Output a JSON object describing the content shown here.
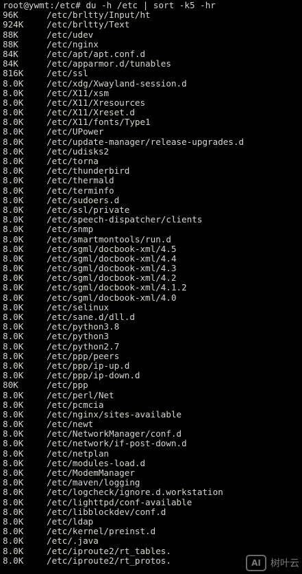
{
  "terminal": {
    "prompt": "root@ywmt:/etc# du -h /etc | sort -k5 -hr",
    "rows": [
      {
        "size": "96K",
        "path": "/etc/brltty/Input/ht"
      },
      {
        "size": "924K",
        "path": "/etc/brltty/Text"
      },
      {
        "size": "88K",
        "path": "/etc/udev"
      },
      {
        "size": "88K",
        "path": "/etc/nginx"
      },
      {
        "size": "84K",
        "path": "/etc/apt/apt.conf.d"
      },
      {
        "size": "84K",
        "path": "/etc/apparmor.d/tunables"
      },
      {
        "size": "816K",
        "path": "/etc/ssl"
      },
      {
        "size": "8.0K",
        "path": "/etc/xdg/Xwayland-session.d"
      },
      {
        "size": "8.0K",
        "path": "/etc/X11/xsm"
      },
      {
        "size": "8.0K",
        "path": "/etc/X11/Xresources"
      },
      {
        "size": "8.0K",
        "path": "/etc/X11/Xreset.d"
      },
      {
        "size": "8.0K",
        "path": "/etc/X11/fonts/Type1"
      },
      {
        "size": "8.0K",
        "path": "/etc/UPower"
      },
      {
        "size": "8.0K",
        "path": "/etc/update-manager/release-upgrades.d"
      },
      {
        "size": "8.0K",
        "path": "/etc/udisks2"
      },
      {
        "size": "8.0K",
        "path": "/etc/torna"
      },
      {
        "size": "8.0K",
        "path": "/etc/thunderbird"
      },
      {
        "size": "8.0K",
        "path": "/etc/thermald"
      },
      {
        "size": "8.0K",
        "path": "/etc/terminfo"
      },
      {
        "size": "8.0K",
        "path": "/etc/sudoers.d"
      },
      {
        "size": "8.0K",
        "path": "/etc/ssl/private"
      },
      {
        "size": "8.0K",
        "path": "/etc/speech-dispatcher/clients"
      },
      {
        "size": "8.0K",
        "path": "/etc/snmp"
      },
      {
        "size": "8.0K",
        "path": "/etc/smartmontools/run.d"
      },
      {
        "size": "8.0K",
        "path": "/etc/sgml/docbook-xml/4.5"
      },
      {
        "size": "8.0K",
        "path": "/etc/sgml/docbook-xml/4.4"
      },
      {
        "size": "8.0K",
        "path": "/etc/sgml/docbook-xml/4.3"
      },
      {
        "size": "8.0K",
        "path": "/etc/sgml/docbook-xml/4.2"
      },
      {
        "size": "8.0K",
        "path": "/etc/sgml/docbook-xml/4.1.2"
      },
      {
        "size": "8.0K",
        "path": "/etc/sgml/docbook-xml/4.0"
      },
      {
        "size": "8.0K",
        "path": "/etc/selinux"
      },
      {
        "size": "8.0K",
        "path": "/etc/sane.d/dll.d"
      },
      {
        "size": "8.0K",
        "path": "/etc/python3.8"
      },
      {
        "size": "8.0K",
        "path": "/etc/python3"
      },
      {
        "size": "8.0K",
        "path": "/etc/python2.7"
      },
      {
        "size": "8.0K",
        "path": "/etc/ppp/peers"
      },
      {
        "size": "8.0K",
        "path": "/etc/ppp/ip-up.d"
      },
      {
        "size": "8.0K",
        "path": "/etc/ppp/ip-down.d"
      },
      {
        "size": "80K",
        "path": "/etc/ppp"
      },
      {
        "size": "8.0K",
        "path": "/etc/perl/Net"
      },
      {
        "size": "8.0K",
        "path": "/etc/pcmcia"
      },
      {
        "size": "8.0K",
        "path": "/etc/nginx/sites-available"
      },
      {
        "size": "8.0K",
        "path": "/etc/newt"
      },
      {
        "size": "8.0K",
        "path": "/etc/NetworkManager/conf.d"
      },
      {
        "size": "8.0K",
        "path": "/etc/network/if-post-down.d"
      },
      {
        "size": "8.0K",
        "path": "/etc/netplan"
      },
      {
        "size": "8.0K",
        "path": "/etc/modules-load.d"
      },
      {
        "size": "8.0K",
        "path": "/etc/ModemManager"
      },
      {
        "size": "8.0K",
        "path": "/etc/maven/logging"
      },
      {
        "size": "8.0K",
        "path": "/etc/logcheck/ignore.d.workstation"
      },
      {
        "size": "8.0K",
        "path": "/etc/lighttpd/conf-available"
      },
      {
        "size": "8.0K",
        "path": "/etc/libblockdev/conf.d"
      },
      {
        "size": "8.0K",
        "path": "/etc/ldap"
      },
      {
        "size": "8.0K",
        "path": "/etc/kernel/preinst.d"
      },
      {
        "size": "8.0K",
        "path": "/etc/.java"
      },
      {
        "size": "8.0K",
        "path": "/etc/iproute2/rt_tables."
      },
      {
        "size": "8.0K",
        "path": "/etc/iproute2/rt_protos."
      }
    ]
  },
  "watermark": {
    "logo": "AI",
    "text": "树叶云"
  },
  "colors": {
    "background": "#000000",
    "foreground": "#d3d7cf"
  }
}
